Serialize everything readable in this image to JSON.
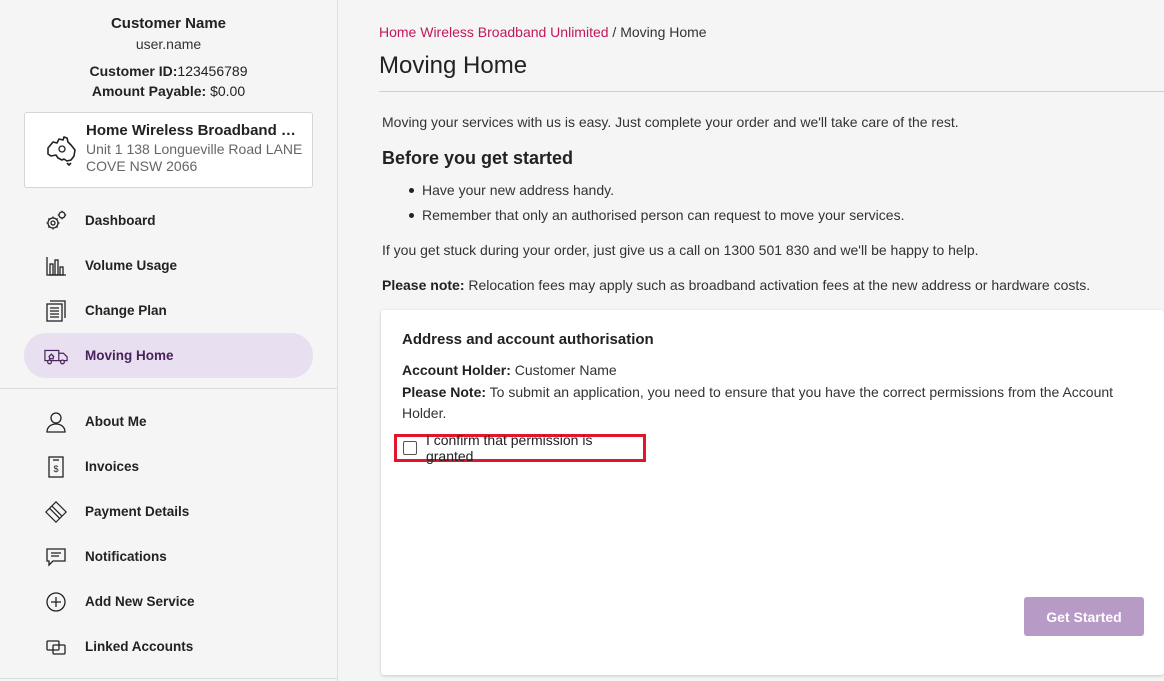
{
  "customer": {
    "name": "Customer Name",
    "username": "user.name",
    "id_label": "Customer ID:",
    "id_value": "123456789",
    "amount_label": "Amount Payable:",
    "amount_value": "$0.00"
  },
  "service": {
    "title": "Home Wireless Broadband Unlimited",
    "address": "Unit 1 138 Longueville Road LANE COVE NSW 2066",
    "icon": "australia-map-icon"
  },
  "nav_primary": [
    {
      "label": "Dashboard",
      "icon": "gears-icon"
    },
    {
      "label": "Volume Usage",
      "icon": "bar-chart-icon"
    },
    {
      "label": "Change Plan",
      "icon": "document-stack-icon"
    },
    {
      "label": "Moving Home",
      "icon": "moving-truck-icon",
      "active": true
    }
  ],
  "nav_secondary": [
    {
      "label": "About Me",
      "icon": "person-icon"
    },
    {
      "label": "Invoices",
      "icon": "invoice-icon"
    },
    {
      "label": "Payment Details",
      "icon": "credit-card-icon"
    },
    {
      "label": "Notifications",
      "icon": "chat-bubble-icon"
    },
    {
      "label": "Add New Service",
      "icon": "plus-circle-icon"
    },
    {
      "label": "Linked Accounts",
      "icon": "linked-squares-icon"
    }
  ],
  "breadcrumb": {
    "link": "Home Wireless Broadband Unlimited",
    "separator": " / ",
    "current": "Moving Home"
  },
  "page": {
    "title": "Moving Home",
    "intro": "Moving your services with us is easy. Just complete your order and we'll take care of the rest.",
    "before_heading": "Before you get started",
    "bullets": [
      "Have your new address handy.",
      "Remember that only an authorised person can request to move your services."
    ],
    "stuck": "If you get stuck during your order, just give us a call on 1300 501 830 and we'll be happy to help.",
    "note_label": "Please note:",
    "note_text": " Relocation fees may apply such as broadband activation fees at the new address or hardware costs."
  },
  "auth": {
    "heading": "Address and account authorisation",
    "holder_label": "Account Holder:",
    "holder_value": " Customer Name",
    "note_label": "Please Note:",
    "note_text": " To submit an application, you need to ensure that you have the correct permissions from the Account Holder.",
    "confirm_label": "I confirm that permission is granted",
    "confirm_checked": false,
    "button_label": "Get Started"
  },
  "colors": {
    "link": "#c2185b",
    "active_nav_bg": "#e8dff0",
    "button_bg": "#b79ac6",
    "highlight_border": "#e0162b"
  }
}
